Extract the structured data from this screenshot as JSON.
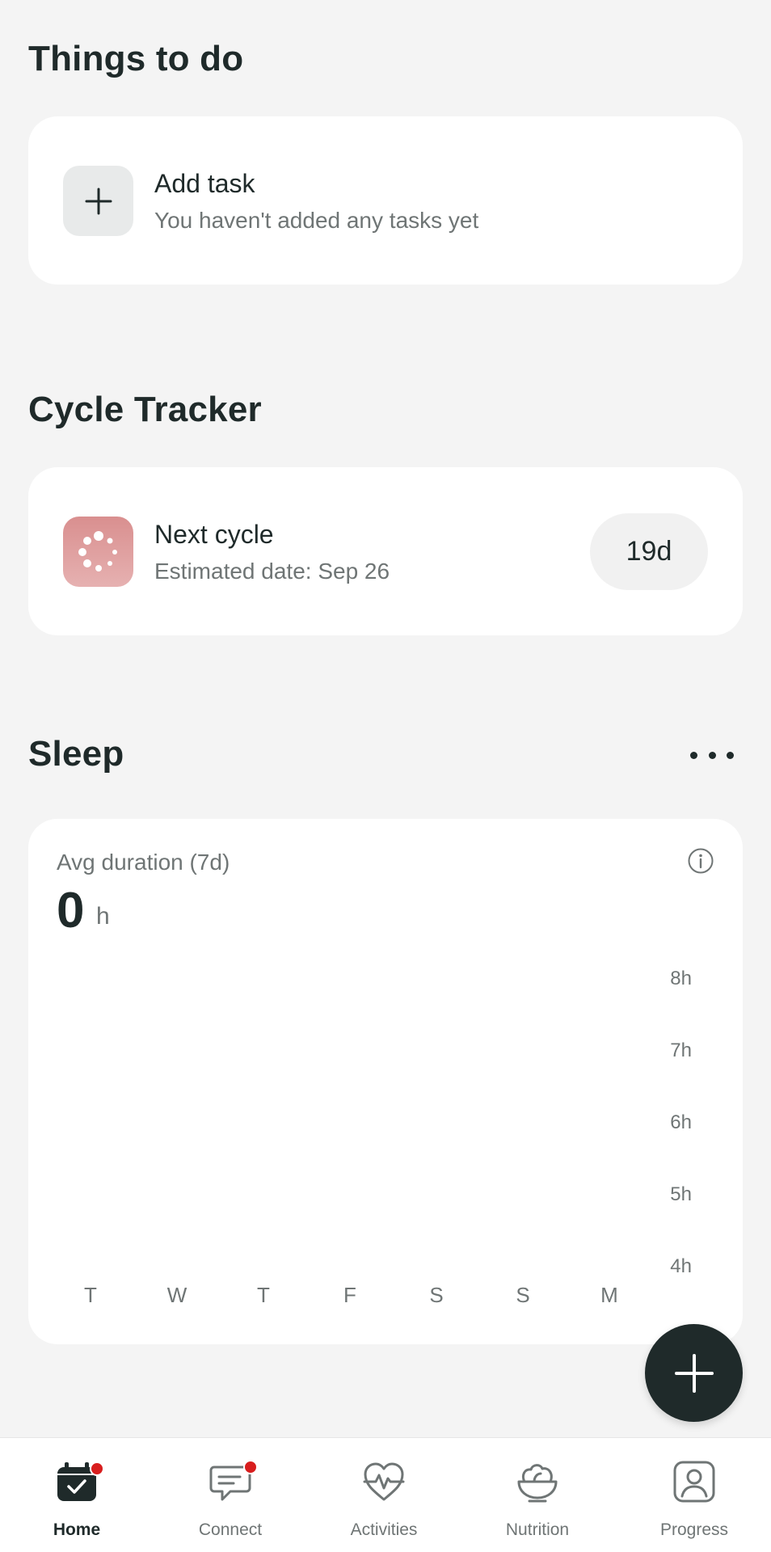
{
  "todo": {
    "title": "Things to do",
    "add_task_title": "Add task",
    "add_task_subtitle": "You haven't added any tasks yet"
  },
  "cycle": {
    "title": "Cycle Tracker",
    "row_title": "Next cycle",
    "row_subtitle": "Estimated date: Sep 26",
    "days_left": "19d",
    "icon_color": "#de9e9e"
  },
  "sleep": {
    "title": "Sleep",
    "avg_label": "Avg duration (7d)",
    "avg_value": "0",
    "avg_unit": "h",
    "y_ticks": [
      "8h",
      "7h",
      "6h",
      "5h",
      "4h"
    ],
    "days": [
      "T",
      "W",
      "T",
      "F",
      "S",
      "S",
      "M"
    ]
  },
  "nav": {
    "items": [
      {
        "label": "Home",
        "icon": "calendar-check-icon",
        "active": true,
        "badge": true
      },
      {
        "label": "Connect",
        "icon": "chat-icon",
        "active": false,
        "badge": true
      },
      {
        "label": "Activities",
        "icon": "heart-pulse-icon",
        "active": false,
        "badge": false
      },
      {
        "label": "Nutrition",
        "icon": "salad-bowl-icon",
        "active": false,
        "badge": false
      },
      {
        "label": "Progress",
        "icon": "profile-icon",
        "active": false,
        "badge": false
      }
    ]
  },
  "colors": {
    "background": "#f4f4f4",
    "primary_dark": "#1f2a2a",
    "badge_red": "#d81e1e"
  }
}
